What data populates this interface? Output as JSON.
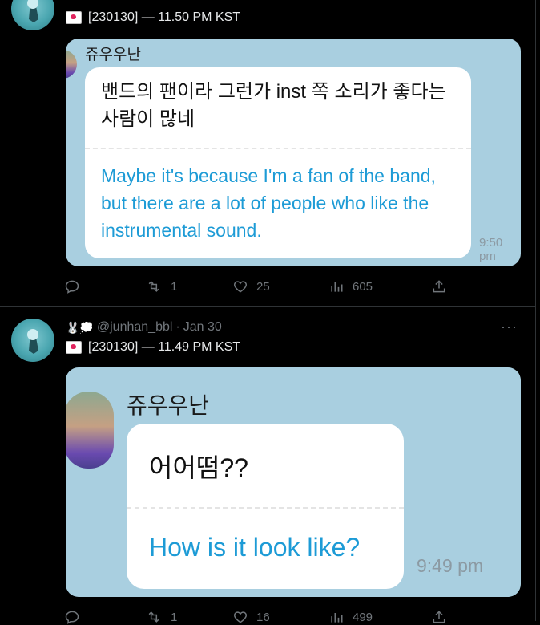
{
  "tweet1": {
    "subtext": "[230130] — 11.50 PM KST",
    "card": {
      "sender": "쥬우우난",
      "korean": "밴드의 팬이라 그런가 inst 쪽 소리가 좋다는 사람이 많네",
      "english": "Maybe it's because I'm a fan of the band, but there are a lot of people who like the instrumental sound.",
      "time": "9:50 pm"
    },
    "actions": {
      "reply": "",
      "retweet": "1",
      "like": "25",
      "views": "605"
    }
  },
  "tweet2": {
    "handle": "@junhan_bbl",
    "separator": "·",
    "date": "Jan 30",
    "name_emojis": "🐰💭",
    "subtext": "[230130] — 11.49 PM KST",
    "more": "···",
    "card": {
      "sender": "쥬우우난",
      "korean": "어어떰??",
      "english": "How is it look like?",
      "time": "9:49 pm"
    },
    "actions": {
      "reply": "",
      "retweet": "1",
      "like": "16",
      "views": "499"
    }
  },
  "colors": {
    "card_bg": "#a9cfe0",
    "english_text": "#1d9bd6",
    "muted": "#71767b"
  }
}
